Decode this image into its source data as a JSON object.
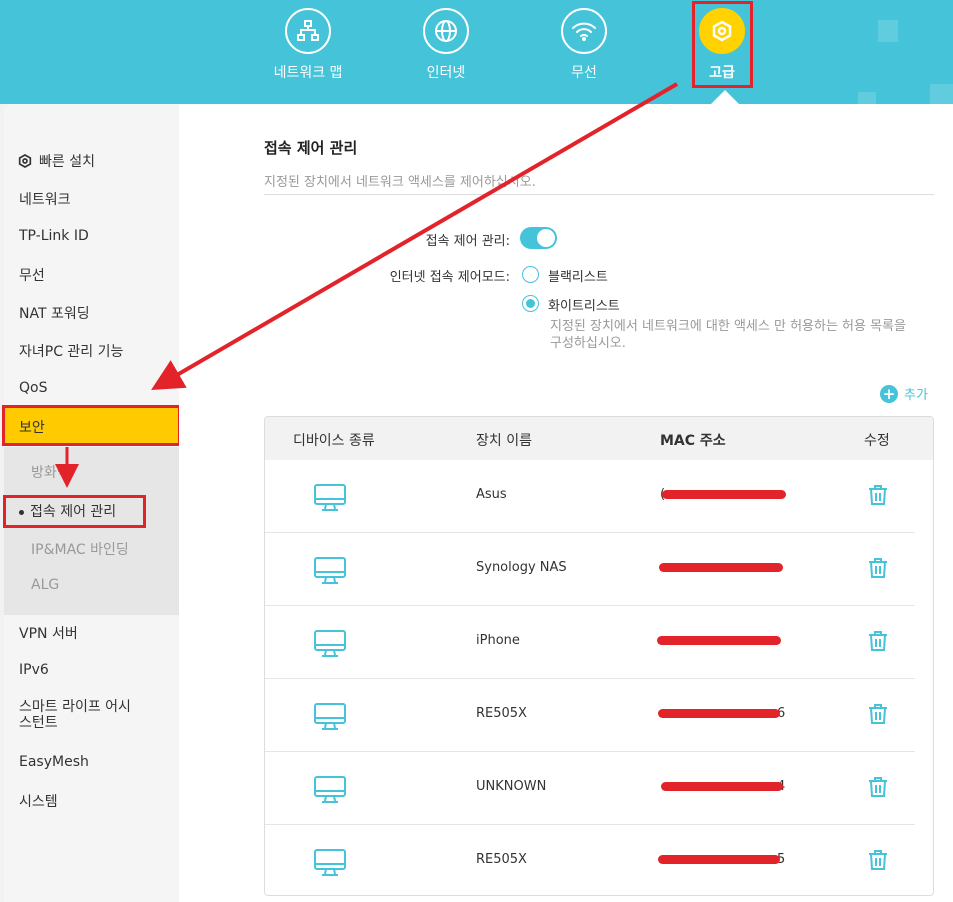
{
  "header": {
    "nav": [
      {
        "label": "네트워크 맵",
        "icon": "network-map-icon"
      },
      {
        "label": "인터넷",
        "icon": "globe-icon"
      },
      {
        "label": "무선",
        "icon": "wifi-icon"
      },
      {
        "label": "고급",
        "icon": "gear-icon",
        "active": true
      }
    ]
  },
  "sidebar": {
    "quick_setup": "빠른 설치",
    "items": [
      "네트워크",
      "TP-Link ID",
      "무선",
      "NAT 포워딩",
      "자녀PC 관리 기능",
      "QoS"
    ],
    "active": "보안",
    "sub_items": [
      "방화벽",
      "접속 제어 관리",
      "IP&MAC 바인딩",
      "ALG"
    ],
    "items_after": [
      "VPN 서버",
      "IPv6",
      "스마트 라이프 어시\n스턴트",
      "EasyMesh",
      "시스템"
    ]
  },
  "main": {
    "title": "접속 제어 관리",
    "subtitle": "지정된 장치에서 네트워크 액세스를 제어하십시오.",
    "toggle_label": "접속 제어 관리:",
    "mode_label": "인터넷 접속 제어모드:",
    "radio_blacklist": "블랙리스트",
    "radio_whitelist": "화이트리스트",
    "whitelist_help": "지정된 장치에서 네트워크에 대한 액세스 만 허용하는 허용 목록을 구성하십시오.",
    "add_label": "추가",
    "table": {
      "headers": [
        "디바이스 종류",
        "장치 이름",
        "MAC 주소",
        "수정"
      ],
      "rows": [
        {
          "name": "Asus",
          "mac_visible": "("
        },
        {
          "name": "Synology NAS",
          "mac_visible": ""
        },
        {
          "name": "iPhone",
          "mac_visible": ""
        },
        {
          "name": "RE505X",
          "mac_visible": "6"
        },
        {
          "name": "UNKNOWN",
          "mac_visible": "4"
        },
        {
          "name": "RE505X",
          "mac_visible": "5"
        }
      ]
    }
  },
  "colors": {
    "accent": "#45c3d8",
    "active_menu": "#ffcb00",
    "annotation_red": "#e2232a"
  }
}
